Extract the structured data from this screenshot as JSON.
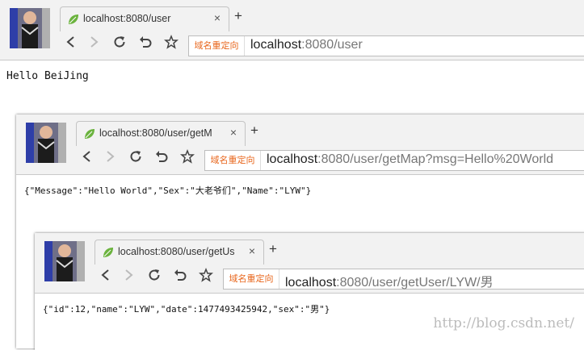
{
  "windows": [
    {
      "tab_title": "localhost:8080/user",
      "address_badge": "域名重定向",
      "url_host": "localhost",
      "url_rest": ":8080/user",
      "body_text": "Hello BeiJing"
    },
    {
      "tab_title": "localhost:8080/user/getM",
      "address_badge": "域名重定向",
      "url_host": "localhost",
      "url_rest": ":8080/user/getMap?msg=Hello%20World",
      "body_text": "{\"Message\":\"Hello World\",\"Sex\":\"大老爷们\",\"Name\":\"LYW\"}"
    },
    {
      "tab_title": "localhost:8080/user/getUs",
      "address_badge": "域名重定向",
      "url_host": "localhost",
      "url_rest": ":8080/user/getUser/LYW/男",
      "body_text": "{\"id\":12,\"name\":\"LYW\",\"date\":1477493425942,\"sex\":\"男\"}"
    }
  ],
  "icons": {
    "tab": "spring-leaf-icon",
    "close": "close-icon",
    "new_tab": "plus-icon",
    "back": "back-arrow-icon",
    "forward": "forward-arrow-icon",
    "reload": "reload-icon",
    "undo": "undo-icon",
    "bookmark": "star-icon"
  },
  "glyphs": {
    "close": "×",
    "new_tab": "+"
  },
  "watermark": "http://blog.csdn.net/",
  "colors": {
    "redirect_badge": "#e8661c",
    "leaf_green": "#6bb33e"
  }
}
